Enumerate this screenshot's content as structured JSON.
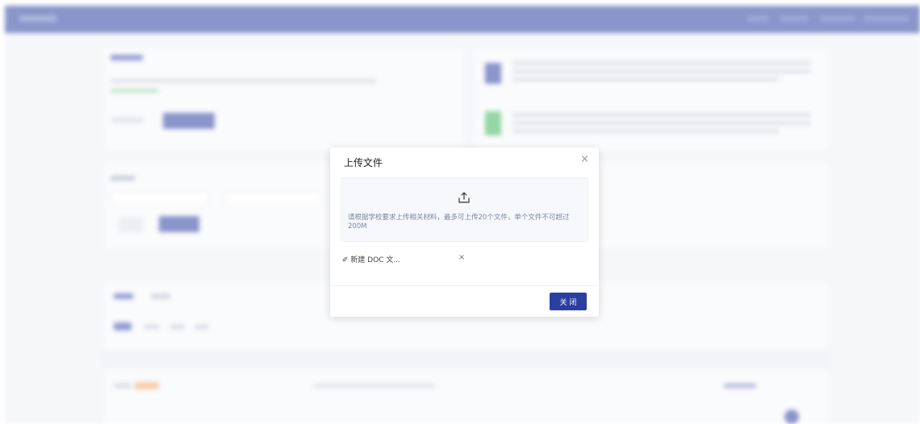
{
  "background": {
    "topbar_color": "#2a3fa0",
    "accent_color": "#2a3fa0",
    "icon_green": "#3cb45a"
  },
  "modal": {
    "title": "上传文件",
    "close_icon": "×",
    "upload_icon_name": "upload-icon",
    "upload_hint": "请根据学校要求上传相关材料，最多可上传20个文件，单个文件不可超过200M",
    "files": [
      {
        "icon_name": "paperclip-icon",
        "icon_glyph": "✐",
        "name": "新建 DOC 文...",
        "remove": "×"
      }
    ],
    "close_button": "关 闭"
  }
}
